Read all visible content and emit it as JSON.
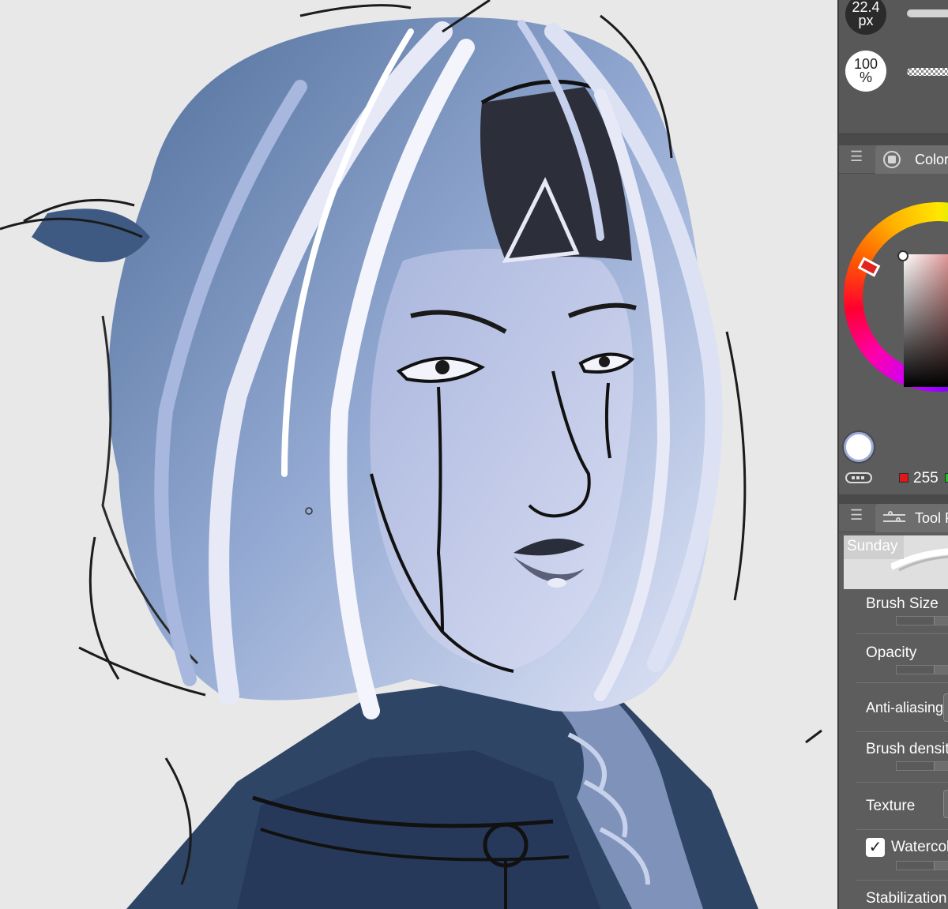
{
  "brush_panel": {
    "size_value": "22.4",
    "size_unit": "px",
    "opacity_value": "100",
    "opacity_unit": "%"
  },
  "color_panel": {
    "menu_icon": "menu-icon",
    "tab_label": "Color",
    "main_color": "#ffffff",
    "hue_color": "#e1231e",
    "red_value": "255"
  },
  "tool_property_panel": {
    "tab_label": "Tool Property",
    "brush_name": "Sunday",
    "properties": {
      "brush_size": "Brush Size",
      "opacity": "Opacity",
      "anti_aliasing": "Anti-aliasing",
      "brush_density": "Brush density",
      "texture": "Texture",
      "watercolor": "Watercolor",
      "stabilization": "Stabilization"
    },
    "watercolor_checked": true
  },
  "colors": {
    "panel_bg": "#5b5b5b",
    "canvas_bg": "#e8e8e8",
    "jacket": "#2e4566",
    "hair_light": "#e7e9f7",
    "hair_mid": "#8fa3cc",
    "skin": "#c9d0ec"
  }
}
